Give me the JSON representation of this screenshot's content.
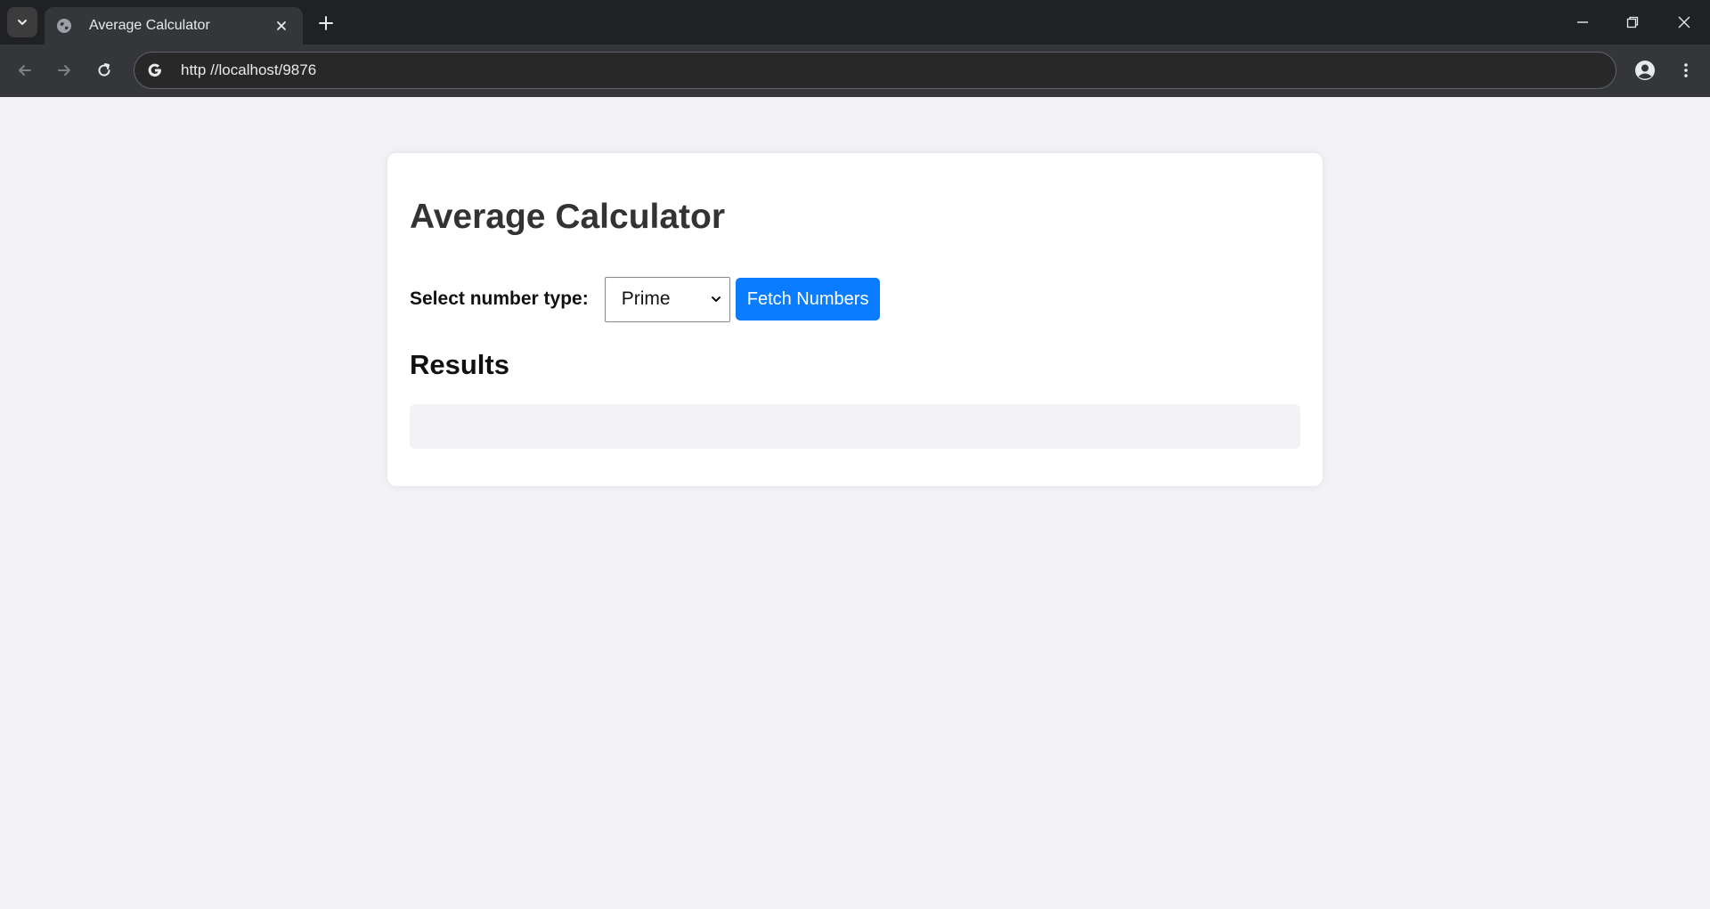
{
  "browser": {
    "tab_title": "Average Calculator",
    "url": "http //localhost/9876"
  },
  "page": {
    "title": "Average Calculator",
    "select_label": "Select number type:",
    "select_value": "Prime",
    "fetch_button": "Fetch Numbers",
    "results_heading": "Results"
  },
  "colors": {
    "accent": "#0a7cff",
    "page_background": "#f3f3f7",
    "chrome_dark": "#202124"
  }
}
